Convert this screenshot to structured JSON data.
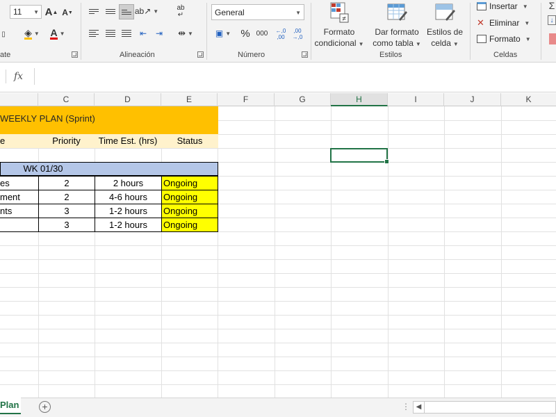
{
  "ribbon": {
    "font_size": "11",
    "number_format": "General",
    "percent": "%",
    "thousands": "000",
    "dec_increase": "←,0 ,00",
    "dec_decrease": ",00 →,0",
    "groups": {
      "font_partial": "ate",
      "alignment": "Alineación",
      "number": "Número",
      "styles": "Estilos",
      "cells": "Celdas"
    },
    "styles_buttons": {
      "conditional_line1": "Formato",
      "conditional_line2": "condicional",
      "table_line1": "Dar formato",
      "table_line2": "como tabla",
      "cell_styles_line1": "Estilos de",
      "cell_styles_line2": "celda"
    },
    "cells_buttons": {
      "insert": "Insertar",
      "delete": "Eliminar",
      "format": "Formato"
    }
  },
  "formula_bar": {
    "fx": "fx",
    "value": ""
  },
  "columns": [
    "C",
    "D",
    "E",
    "F",
    "G",
    "H",
    "I",
    "J",
    "K"
  ],
  "active_column": "H",
  "sheet": {
    "title": "WEEKLY PLAN (Sprint)",
    "header_partial": "e",
    "headers": [
      "Priority",
      "Time Est. (hrs)",
      "Status"
    ],
    "week": "WK 01/30",
    "rows": [
      {
        "task": "es",
        "priority": "2",
        "time": "2 hours",
        "status": "Ongoing"
      },
      {
        "task": "ment",
        "priority": "2",
        "time": "4-6 hours",
        "status": "Ongoing"
      },
      {
        "task": "nts",
        "priority": "3",
        "time": "1-2 hours",
        "status": "Ongoing"
      },
      {
        "task": "",
        "priority": "3",
        "time": "1-2 hours",
        "status": "Ongoing"
      }
    ]
  },
  "tabs": {
    "sheet_name": "Plan",
    "add": "+",
    "dots": "⋮"
  },
  "colors": {
    "title_band": "#ffc000",
    "header_band": "#fff2cc",
    "week_band": "#b4c6e7",
    "status": "#ffff00",
    "excel_green": "#217346"
  }
}
